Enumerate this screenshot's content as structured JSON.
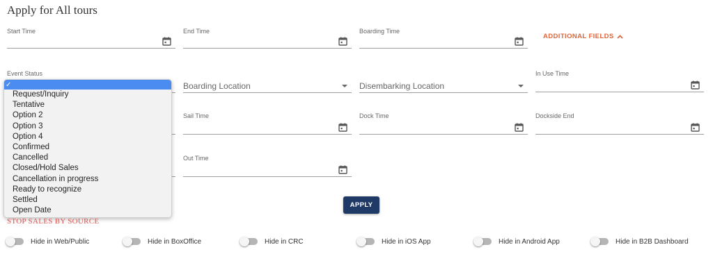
{
  "page": {
    "title": "Apply for All tours"
  },
  "fields": {
    "start_time": {
      "label": "Start Time"
    },
    "end_time": {
      "label": "End Time"
    },
    "boarding_time": {
      "label": "Boarding Time"
    },
    "event_status": {
      "label": "Event Status"
    },
    "boarding_location": {
      "placeholder": "Boarding Location"
    },
    "disembarking_location": {
      "placeholder": "Disembarking Location"
    },
    "in_use_time": {
      "label": "In Use Time"
    },
    "sail_time": {
      "label": "Sail Time"
    },
    "dock_time": {
      "label": "Dock Time"
    },
    "dockside_end": {
      "label": "Dockside End"
    },
    "out_time": {
      "label": "Out Time"
    }
  },
  "additional_fields": {
    "label": "ADDITIONAL FIELDS"
  },
  "event_status_dropdown": {
    "selected_mark": "✓",
    "options": [
      "Request/Inquiry",
      "Tentative",
      "Option 2",
      "Option 3",
      "Option 4",
      "Confirmed",
      "Cancelled",
      "Closed/Hold Sales",
      "Cancellation in progress",
      "Ready to recognize",
      "Settled",
      "Open Date"
    ]
  },
  "apply_button": {
    "label": "APPLY"
  },
  "stop_sales": {
    "title": "STOP SALES BY SOURCE",
    "toggles": [
      {
        "label": "Hide in Web/Public",
        "on": false
      },
      {
        "label": "Hide in BoxOffice",
        "on": false
      },
      {
        "label": "Hide in CRC",
        "on": false
      },
      {
        "label": "Hide in iOS App",
        "on": false
      },
      {
        "label": "Hide in Android App",
        "on": false
      },
      {
        "label": "Hide in B2B Dashboard",
        "on": false
      }
    ]
  },
  "colors": {
    "accent": "#e0653a",
    "primary_button": "#1f3a66",
    "stop_sales_title": "#d9534f",
    "dropdown_selected": "#4a8cf0"
  },
  "icons": {
    "calendar": "calendar-icon",
    "chevron_up": "chevron-up-icon",
    "caret_down": "caret-down-icon",
    "check": "check-icon"
  }
}
